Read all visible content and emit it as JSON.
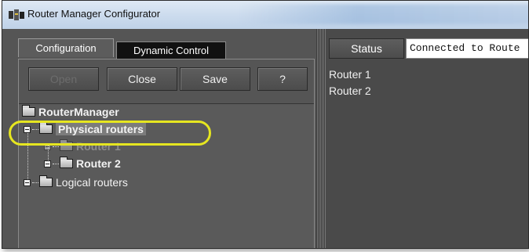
{
  "window": {
    "title": "Router Manager Configurator"
  },
  "tabs": [
    {
      "label": "Configuration",
      "selected": true
    },
    {
      "label": "Dynamic Control",
      "selected": false
    }
  ],
  "toolbar": {
    "open_label": "Open",
    "close_label": "Close",
    "save_label": "Save",
    "help_label": "?"
  },
  "tree": {
    "root": "RouterManager",
    "physical": "Physical routers",
    "router1": "Router 1",
    "router2": "Router 2",
    "logical": "Logical routers"
  },
  "status": {
    "button_label": "Status",
    "field_value": "Connected to Route",
    "items": [
      "Router 1",
      "Router 2"
    ]
  },
  "colors": {
    "highlight": "#e6e620",
    "window_bg": "#5a5a5a"
  }
}
